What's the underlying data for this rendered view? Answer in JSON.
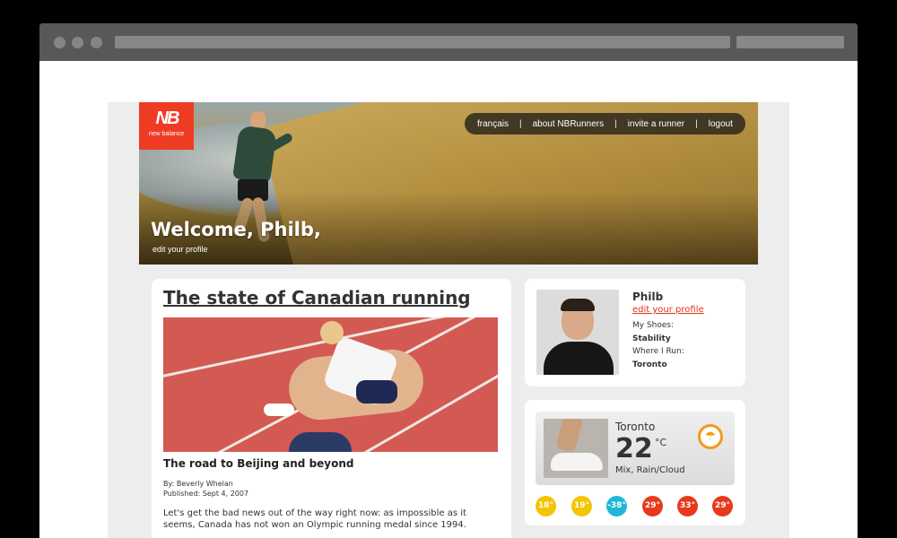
{
  "nav": {
    "items": [
      "français",
      "about NBRunners",
      "invite a runner",
      "logout"
    ],
    "separator": "|"
  },
  "brand": {
    "logo_mark": "NB",
    "logo_text": "new balance",
    "color": "#ef3b24"
  },
  "banner": {
    "welcome": "Welcome, Philb,",
    "edit_profile": "edit your profile"
  },
  "article": {
    "title": "The state of Canadian running",
    "subtitle": "The road to Beijing and beyond",
    "byline": "By: Beverly Whelan",
    "published": "Published: Sept 4, 2007",
    "body": "Let's get the bad news out of the way right now: as impossible as it seems, Canada has not won an Olympic running medal since 1994."
  },
  "profile": {
    "name": "Philb",
    "edit_link": "edit your profile",
    "shoes_label": "My Shoes:",
    "shoes_value": "Stability",
    "run_label": "Where I Run:",
    "run_value": "Toronto"
  },
  "weather": {
    "city": "Toronto",
    "temp": "22",
    "unit": "°C",
    "condition": "Mix, Rain/Cloud",
    "icon": "rain-cloud-icon",
    "forecast": [
      {
        "label": "18°",
        "color": "#f5c400"
      },
      {
        "label": "19°",
        "color": "#f5c400"
      },
      {
        "label": "-38°",
        "color": "#1fb7d8"
      },
      {
        "label": "29°",
        "color": "#e8391c"
      },
      {
        "label": "33°",
        "color": "#e8391c"
      },
      {
        "label": "29°",
        "color": "#e8391c"
      }
    ]
  }
}
